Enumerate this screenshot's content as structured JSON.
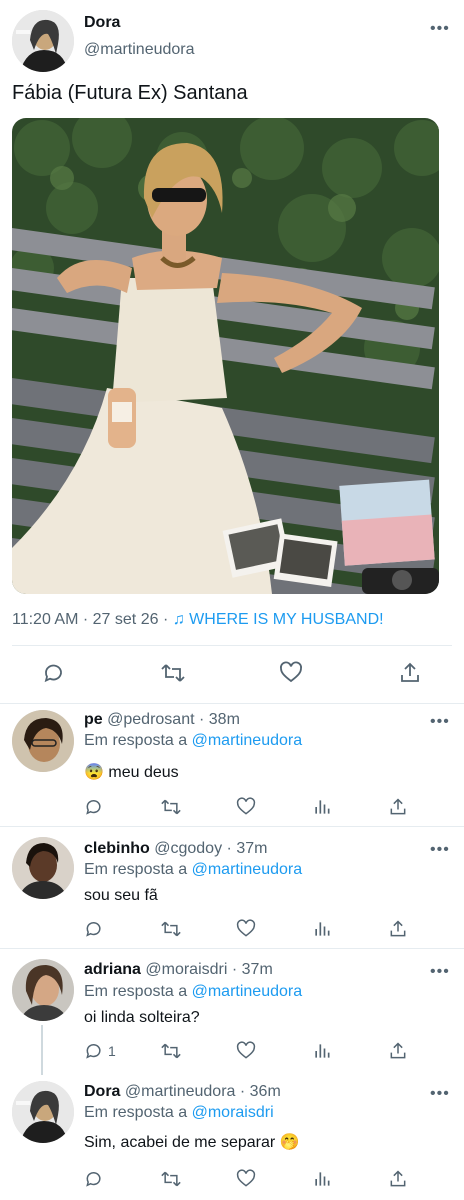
{
  "main_tweet": {
    "author_name": "Dora",
    "author_handle": "@martineudora",
    "text": "Fábia (Futura Ex) Santana",
    "time": "11:20 AM",
    "date": "27 set 26",
    "source_note": "♫",
    "source": "WHERE IS MY HUSBAND!",
    "more_icon": "more-dots-icon"
  },
  "replies": [
    {
      "name": "pe",
      "handle": "@pedrosant",
      "age": "38m",
      "reply_prefix": "Em resposta a",
      "reply_to": "@martineudora",
      "text": "😨 meu deus",
      "reply_count": ""
    },
    {
      "name": "clebinho",
      "handle": "@cgodoy",
      "age": "37m",
      "reply_prefix": "Em resposta a",
      "reply_to": "@martineudora",
      "text": "sou seu fã",
      "reply_count": ""
    },
    {
      "name": "adriana",
      "handle": "@moraisdri",
      "age": "37m",
      "reply_prefix": "Em resposta a",
      "reply_to": "@martineudora",
      "text": "oi linda solteira?",
      "reply_count": "1"
    },
    {
      "name": "Dora",
      "handle": "@martineudora",
      "age": "36m",
      "reply_prefix": "Em resposta a",
      "reply_to": "@moraisdri",
      "text": "Sim, acabei de me separar 🤭",
      "reply_count": ""
    }
  ],
  "separator": "·",
  "colors": {
    "link": "#1d9bf0",
    "secondary_text": "#536471",
    "divider": "#e6ecf0"
  }
}
